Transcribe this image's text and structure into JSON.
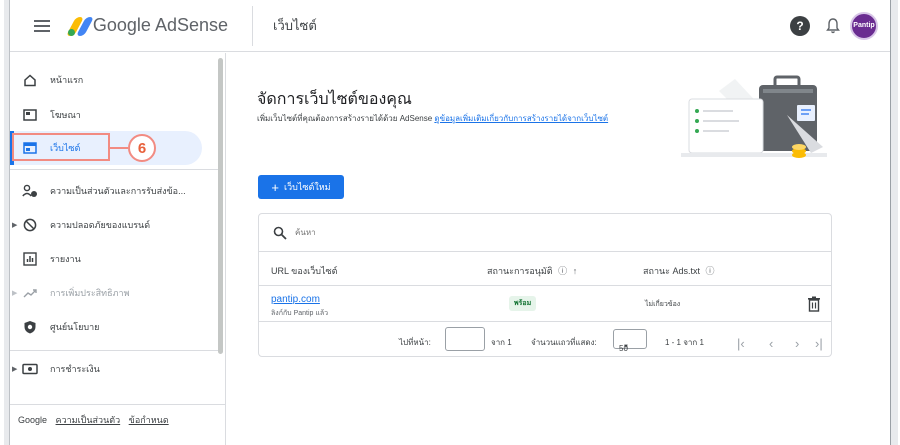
{
  "app": {
    "name": "Google AdSense"
  },
  "header": {
    "page_title": "เว็บไซต์",
    "avatar_label": "Pantip"
  },
  "sidebar": {
    "items": [
      {
        "label": "หน้าแรก",
        "icon": "home-icon"
      },
      {
        "label": "โฆษณา",
        "icon": "ads-icon"
      },
      {
        "label": "เว็บไซต์",
        "icon": "sites-icon",
        "active": true
      },
      {
        "label": "ความเป็นส่วนตัวและการรับส่งข้อ...",
        "icon": "privacy-icon"
      },
      {
        "label": "ความปลอดภัยของแบรนด์",
        "icon": "block-icon"
      },
      {
        "label": "รายงาน",
        "icon": "reports-icon"
      },
      {
        "label": "การเพิ่มประสิทธิภาพ",
        "icon": "trending-icon",
        "disabled": true
      },
      {
        "label": "ศูนย์นโยบาย",
        "icon": "policy-icon"
      },
      {
        "label": "การชำระเงิน",
        "icon": "payments-icon"
      }
    ],
    "step_number": "6",
    "footer": {
      "brand": "Google",
      "privacy": "ความเป็นส่วนตัว",
      "terms": "ข้อกำหนด"
    }
  },
  "main": {
    "title": "จัดการเว็บไซต์ของคุณ",
    "description": "เพิ่มเว็บไซต์ที่คุณต้องการสร้างรายได้ด้วย AdSense",
    "description_link": "ดูข้อมูลเพิ่มเติมเกี่ยวกับการสร้างรายได้จากเว็บไซต์",
    "new_site_button": "เว็บไซต์ใหม่",
    "search_placeholder": "ค้นหา",
    "table": {
      "headers": {
        "url": "URL ของเว็บไซต์",
        "approval": "สถานะการอนุมัติ",
        "ads_txt": "สถานะ Ads.txt"
      },
      "rows": [
        {
          "url": "pantip.com",
          "sub": "ลิงก์กับ Pantip แล้ว",
          "approval": "พร้อม",
          "ads_txt": "ไม่เกี่ยวข้อง"
        }
      ]
    },
    "pagination": {
      "goto_label": "ไปที่หน้า:",
      "of_pages": "จาก 1",
      "rows_label": "จำนวนแถวที่แสดง:",
      "rows_value": "50",
      "range": "1 - 1 จาก 1"
    }
  },
  "colors": {
    "accent": "#1a73e8",
    "highlight": "#f28b82",
    "success_bg": "#e6f4ea",
    "success_text": "#137333"
  }
}
